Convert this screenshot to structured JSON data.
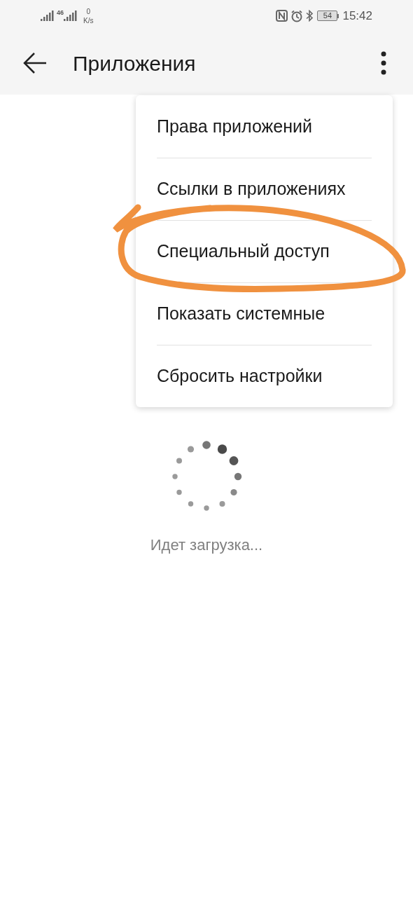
{
  "status_bar": {
    "network_type": "46",
    "speed_value": "0",
    "speed_unit": "K/s",
    "battery": "54",
    "time": "15:42"
  },
  "app_bar": {
    "title": "Приложения"
  },
  "menu": {
    "items": [
      {
        "label": "Права приложений"
      },
      {
        "label": "Ссылки в приложениях"
      },
      {
        "label": "Специальный доступ"
      },
      {
        "label": "Показать системные"
      },
      {
        "label": "Сбросить настройки"
      }
    ]
  },
  "loading": {
    "text": "Идет загрузка..."
  }
}
